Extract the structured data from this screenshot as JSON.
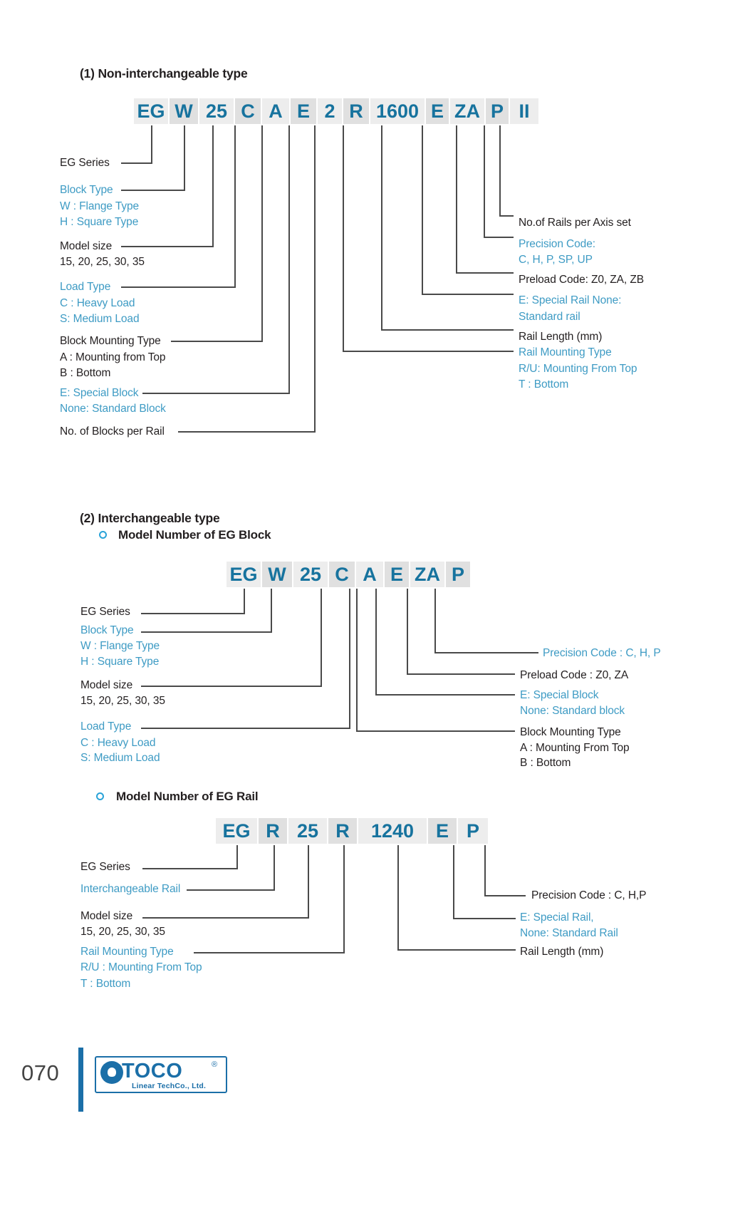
{
  "page": {
    "number": "070",
    "logo": {
      "name": "TOCO",
      "registered": "®",
      "tagline": "Linear TechCo., Ltd."
    }
  },
  "section1": {
    "heading": "(1) Non-interchangeable type",
    "code_cells": [
      {
        "text": "EG"
      },
      {
        "text": "W"
      },
      {
        "text": "25"
      },
      {
        "text": "C"
      },
      {
        "text": "A"
      },
      {
        "text": "E"
      },
      {
        "text": "2"
      },
      {
        "text": "R"
      },
      {
        "text": "1600"
      },
      {
        "text": "E"
      },
      {
        "text": "ZA"
      },
      {
        "text": "P"
      },
      {
        "text": "II"
      }
    ],
    "left_labels": [
      {
        "lines": [
          "EG Series"
        ],
        "color": "black"
      },
      {
        "lines": [
          "Block  Type",
          "W : Flange Type",
          "H : Square Type"
        ],
        "color": "blue"
      },
      {
        "lines": [
          "Model size",
          "15, 20, 25, 30, 35"
        ],
        "color": "black"
      },
      {
        "lines": [
          "Load Type",
          "C : Heavy Load",
          "S: Medium Load"
        ],
        "color": "blue"
      },
      {
        "lines": [
          "Block Mounting Type",
          "A : Mounting from Top",
          "B : Bottom"
        ],
        "color": "black"
      },
      {
        "lines": [
          "E: Special Block",
          "None: Standard Block"
        ],
        "color": "blue"
      },
      {
        "lines": [
          "No. of Blocks per Rail"
        ],
        "color": "black"
      }
    ],
    "right_labels": [
      {
        "lines": [
          "No.of Rails per Axis set"
        ],
        "color": "black"
      },
      {
        "lines": [
          "Precision Code:",
          "C, H, P, SP, UP"
        ],
        "color": "blue"
      },
      {
        "lines": [
          "Preload Code: Z0, ZA, ZB"
        ],
        "color": "black"
      },
      {
        "lines": [
          "E: Special Rail None:",
          "Standard rail"
        ],
        "color": "blue"
      },
      {
        "lines": [
          "Rail Length (mm)"
        ],
        "color": "black"
      },
      {
        "lines": [
          "Rail Mounting Type",
          "R/U: Mounting From Top",
          "T : Bottom"
        ],
        "color": "blue"
      }
    ]
  },
  "section2": {
    "heading": "(2) Interchangeable type",
    "block": {
      "title": "Model Number of EG Block",
      "code_cells": [
        {
          "text": "EG"
        },
        {
          "text": "W"
        },
        {
          "text": "25"
        },
        {
          "text": "C"
        },
        {
          "text": "A"
        },
        {
          "text": "E"
        },
        {
          "text": "ZA"
        },
        {
          "text": "P"
        }
      ],
      "left_labels": [
        {
          "lines": [
            "EG Series"
          ],
          "color": "black"
        },
        {
          "lines": [
            "Block Type",
            "W : Flange Type",
            "H : Square Type"
          ],
          "color": "blue"
        },
        {
          "lines": [
            "Model size",
            "15, 20, 25, 30, 35"
          ],
          "color": "black"
        },
        {
          "lines": [
            "Load Type",
            "C : Heavy Load",
            "S: Medium Load"
          ],
          "color": "blue"
        }
      ],
      "right_labels": [
        {
          "lines": [
            "Precision Code : C, H, P"
          ],
          "color": "blue"
        },
        {
          "lines": [
            "Preload Code : Z0, ZA"
          ],
          "color": "black"
        },
        {
          "lines": [
            "E: Special Block",
            "None: Standard block"
          ],
          "color": "blue"
        },
        {
          "lines": [
            "Block Mounting Type",
            "A : Mounting From Top",
            "B : Bottom"
          ],
          "color": "black"
        }
      ]
    },
    "rail": {
      "title": "Model Number of EG Rail",
      "code_cells": [
        {
          "text": "EG"
        },
        {
          "text": "R"
        },
        {
          "text": "25"
        },
        {
          "text": "R"
        },
        {
          "text": "1240"
        },
        {
          "text": "E"
        },
        {
          "text": "P"
        }
      ],
      "left_labels": [
        {
          "lines": [
            "EG Series"
          ],
          "color": "black"
        },
        {
          "lines": [
            "Interchangeable Rail"
          ],
          "color": "blue"
        },
        {
          "lines": [
            "Model size",
            "15, 20, 25, 30, 35"
          ],
          "color": "black"
        },
        {
          "lines": [
            "Rail Mounting Type",
            "R/U : Mounting From Top",
            "T : Bottom"
          ],
          "color": "blue"
        }
      ],
      "right_labels": [
        {
          "lines": [
            "Precision Code : C, H,P"
          ],
          "color": "black"
        },
        {
          "lines": [
            "E: Special Rail,",
            "None: Standard Rail"
          ],
          "color": "blue"
        },
        {
          "lines": [
            "Rail Length (mm)"
          ],
          "color": "black"
        }
      ]
    }
  },
  "colors": {
    "accent_blue": "#17739e",
    "label_blue": "#3e9bc4",
    "cell_light": "#ededed",
    "cell_dark": "#e0e0e0",
    "line": "#4a4a4a",
    "brand": "#1b6fa8"
  }
}
